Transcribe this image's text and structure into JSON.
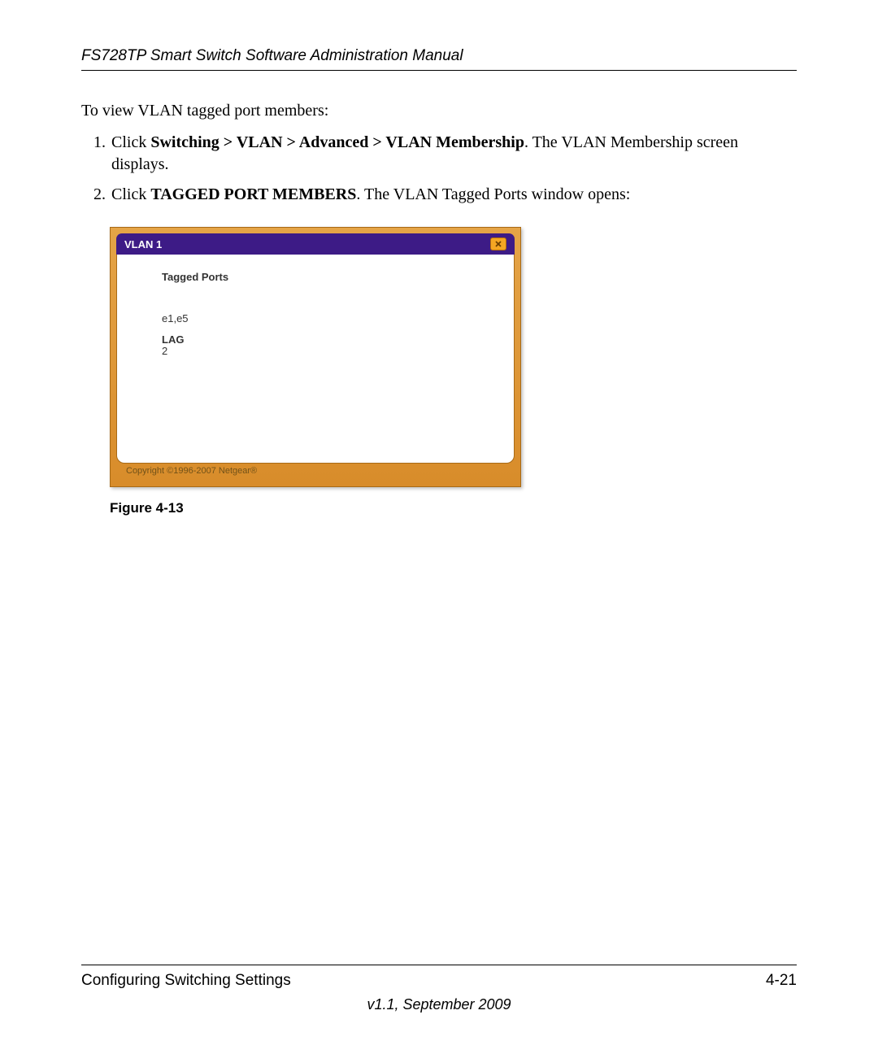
{
  "header": {
    "title": "FS728TP Smart Switch Software Administration Manual"
  },
  "body": {
    "intro": "To view VLAN tagged port members:",
    "steps": [
      {
        "prefix": "Click ",
        "bold": "Switching > VLAN > Advanced > VLAN Membership",
        "suffix": ". The VLAN Membership screen displays."
      },
      {
        "prefix": "Click ",
        "bold": "TAGGED PORT MEMBERS",
        "suffix": ". The VLAN Tagged Ports window opens:"
      }
    ]
  },
  "vlan_window": {
    "title": "VLAN 1",
    "section_title": "Tagged Ports",
    "port_list": "e1,e5",
    "lag_label": "LAG",
    "lag_value": "2",
    "copyright": "Copyright ©1996-2007 Netgear®"
  },
  "figure": {
    "caption": "Figure 4-13"
  },
  "footer": {
    "left": "Configuring Switching Settings",
    "right": "4-21",
    "version": "v1.1, September 2009"
  }
}
